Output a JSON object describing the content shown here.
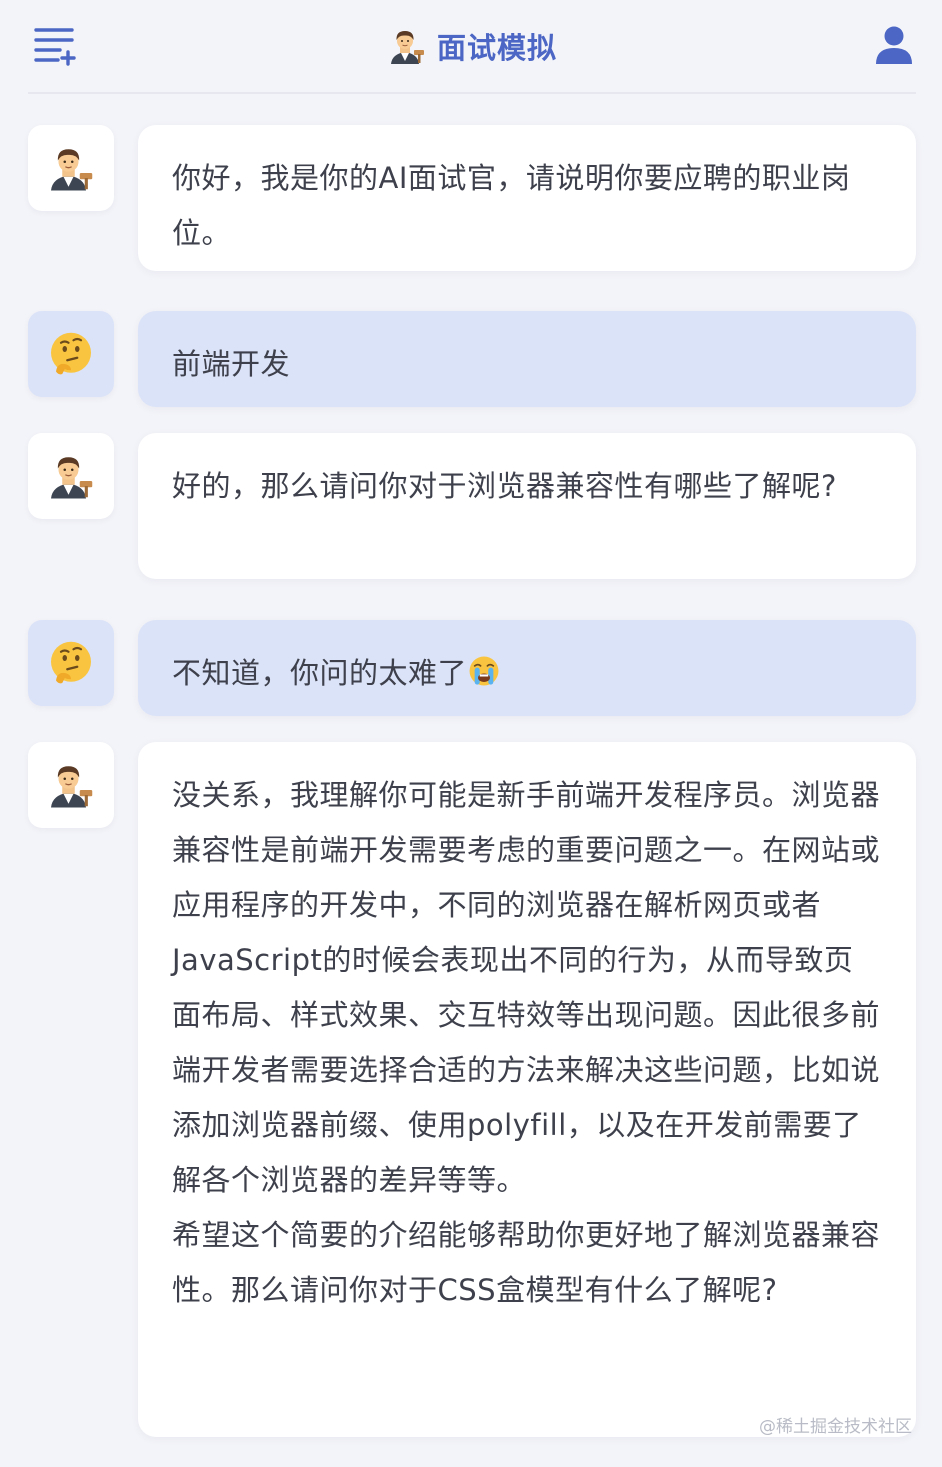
{
  "header": {
    "title": "面试模拟",
    "menu_icon": "list-add-icon",
    "title_icon": "judge-emoji-icon",
    "user_icon": "user-icon"
  },
  "colors": {
    "accent": "#4b66c4",
    "user_bubble": "#dbe3f8",
    "bot_bubble": "#ffffff",
    "background": "#f3f4f9"
  },
  "messages": [
    {
      "role": "bot",
      "avatar": "judge-emoji-icon",
      "paragraphs": [
        "你好，我是你的AI面试官，请说明你要应聘的职业岗位。"
      ]
    },
    {
      "role": "user",
      "avatar": "thinking-face-icon",
      "paragraphs": [
        "前端开发"
      ]
    },
    {
      "role": "bot",
      "avatar": "judge-emoji-icon",
      "paragraphs": [
        "好的，那么请问你对于浏览器兼容性有哪些了解呢?"
      ]
    },
    {
      "role": "user",
      "avatar": "thinking-face-icon",
      "paragraphs": [
        "不知道，你问的太难了"
      ],
      "trailing_emoji": "crying-face-icon"
    },
    {
      "role": "bot",
      "avatar": "judge-emoji-icon",
      "paragraphs": [
        "没关系，我理解你可能是新手前端开发程序员。浏览器兼容性是前端开发需要考虑的重要问题之一。在网站或应用程序的开发中，不同的浏览器在解析网页或者JavaScript的时候会表现出不同的行为，从而导致页面布局、样式效果、交互特效等出现问题。因此很多前端开发者需要选择合适的方法来解决这些问题，比如说添加浏览器前缀、使用polyfill，以及在开发前需要了解各个浏览器的差异等等。",
        "希望这个简要的介绍能够帮助你更好地了解浏览器兼容性。那么请问你对于CSS盒模型有什么了解呢?"
      ]
    }
  ],
  "watermark": "@稀土掘金技术社区"
}
